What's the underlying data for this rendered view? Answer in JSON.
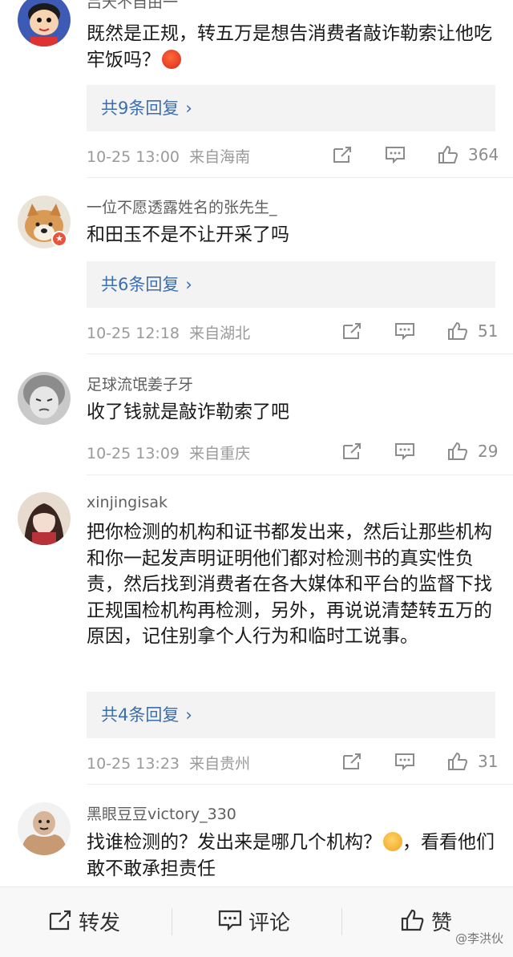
{
  "comments": [
    {
      "username": "吕天不自由一",
      "text_parts": [
        "既然是正规，转五万是想告消费者敲诈勒索让他吃牢饭吗？"
      ],
      "reply_label": "共9条回复",
      "time": "10-25 13:00",
      "location": "来自海南",
      "likes": "364",
      "avatar_icon": "cartoon-boy-avatar",
      "emoji": "angry-face-emoji"
    },
    {
      "username": "一位不愿透露姓名的张先生_",
      "text_parts": [
        "和田玉不是不让开采了吗"
      ],
      "reply_label": "共6条回复",
      "time": "10-25 12:18",
      "location": "来自湖北",
      "likes": "51",
      "avatar_icon": "shiba-dog-avatar"
    },
    {
      "username": "足球流氓姜子牙",
      "text_parts": [
        "收了钱就是敲诈勒索了吧"
      ],
      "time": "10-25 13:09",
      "location": "来自重庆",
      "likes": "29",
      "avatar_icon": "grumpy-girl-avatar"
    },
    {
      "username": "xinjingisak",
      "text_parts": [
        "把你检测的机构和证书都发出来，然后让那些机构和你一起发声明证明他们都对检测书的真实性负责，然后找到消费者在各大媒体和平台的监督下找正规国检机构再检测，另外，再说说清楚转五万的原因，记住别拿个人行为和临时工说事。"
      ],
      "reply_label": "共4条回复",
      "time": "10-25 13:23",
      "location": "来自贵州",
      "likes": "31",
      "avatar_icon": "anime-character-avatar"
    },
    {
      "username": "黑眼豆豆victory_330",
      "text_parts": [
        "找谁检测的？发出来是哪几个机构？",
        "，看看他们敢不敢承担责任"
      ],
      "avatar_icon": "muscle-meme-avatar",
      "emoji": "yum-face-emoji"
    }
  ],
  "bottom_bar": {
    "repost_label": "转发",
    "comment_label": "评论",
    "like_label": "赞"
  },
  "watermark": "@李洪伙",
  "colors": {
    "link": "#3b6eae",
    "meta": "#9a9a9a",
    "reply_bg": "#f3f3f3",
    "badge": "#e8543c"
  }
}
